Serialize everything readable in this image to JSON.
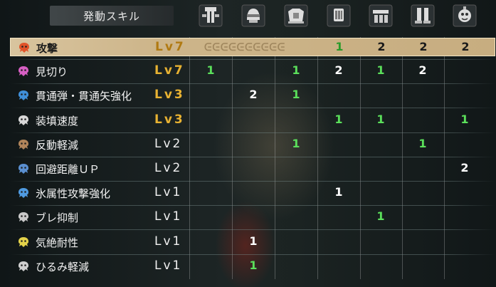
{
  "header": {
    "title": "発動スキル",
    "equipment": [
      {
        "slot": "weapon",
        "icon": "weapon-icon"
      },
      {
        "slot": "head",
        "icon": "helmet-icon"
      },
      {
        "slot": "chest",
        "icon": "chest-armor-icon"
      },
      {
        "slot": "arms",
        "icon": "gauntlet-icon"
      },
      {
        "slot": "waist",
        "icon": "waist-armor-icon"
      },
      {
        "slot": "legs",
        "icon": "greaves-icon"
      },
      {
        "slot": "charm",
        "icon": "charm-icon"
      }
    ]
  },
  "skills": [
    {
      "name": "攻撃",
      "level": "Lv7",
      "maxed": true,
      "icon_color": "#e0542a",
      "selected": true,
      "counts": [
        "",
        "",
        "",
        "1",
        "2",
        "2",
        "2"
      ],
      "count_colors": [
        "",
        "",
        "",
        "green",
        "white",
        "white",
        "white"
      ],
      "pattern": "ᕮᕮᕮᕮᕮᕮᕮᕮᕮᕮ"
    },
    {
      "name": "見切り",
      "level": "Lv7",
      "maxed": true,
      "icon_color": "#d65fc3",
      "counts": [
        "1",
        "",
        "1",
        "2",
        "1",
        "2",
        ""
      ],
      "count_colors": [
        "green",
        "",
        "green",
        "white",
        "green",
        "white",
        ""
      ]
    },
    {
      "name": "貫通弾・貫通矢強化",
      "level": "Lv3",
      "maxed": true,
      "icon_color": "#3f8fd8",
      "counts": [
        "",
        "2",
        "1",
        "",
        "",
        "",
        ""
      ],
      "count_colors": [
        "",
        "white",
        "green",
        "",
        "",
        "",
        ""
      ]
    },
    {
      "name": "装填速度",
      "level": "Lv3",
      "maxed": true,
      "icon_color": "#d8d8d8",
      "counts": [
        "",
        "",
        "",
        "1",
        "1",
        "",
        "1"
      ],
      "count_colors": [
        "",
        "",
        "",
        "green",
        "green",
        "",
        "green"
      ]
    },
    {
      "name": "反動軽減",
      "level": "Lv2",
      "maxed": false,
      "icon_color": "#b0845a",
      "counts": [
        "",
        "",
        "1",
        "",
        "",
        "1",
        ""
      ],
      "count_colors": [
        "",
        "",
        "green",
        "",
        "",
        "green",
        ""
      ]
    },
    {
      "name": "回避距離ＵＰ",
      "level": "Lv2",
      "maxed": false,
      "icon_color": "#5a8fd0",
      "counts": [
        "",
        "",
        "",
        "",
        "",
        "",
        "2"
      ],
      "count_colors": [
        "",
        "",
        "",
        "",
        "",
        "",
        "white"
      ]
    },
    {
      "name": "氷属性攻撃強化",
      "level": "Lv1",
      "maxed": false,
      "icon_color": "#4f9ae0",
      "counts": [
        "",
        "",
        "",
        "1",
        "",
        "",
        ""
      ],
      "count_colors": [
        "",
        "",
        "",
        "white",
        "",
        "",
        ""
      ]
    },
    {
      "name": "ブレ抑制",
      "level": "Lv1",
      "maxed": false,
      "icon_color": "#c9c9c9",
      "counts": [
        "",
        "",
        "",
        "",
        "1",
        "",
        ""
      ],
      "count_colors": [
        "",
        "",
        "",
        "",
        "green",
        "",
        ""
      ]
    },
    {
      "name": "気絶耐性",
      "level": "Lv1",
      "maxed": false,
      "icon_color": "#e3d24a",
      "counts": [
        "",
        "1",
        "",
        "",
        "",
        "",
        ""
      ],
      "count_colors": [
        "",
        "white",
        "",
        "",
        "",
        "",
        ""
      ]
    },
    {
      "name": "ひるみ軽減",
      "level": "Lv1",
      "maxed": false,
      "icon_color": "#cfcfcf",
      "counts": [
        "",
        "1",
        "",
        "",
        "",
        "",
        ""
      ],
      "count_colors": [
        "",
        "green",
        "",
        "",
        "",
        "",
        ""
      ]
    }
  ],
  "colors": {
    "selected_row": "#d8c49e",
    "maxed_level": "#e8b232",
    "count_green": "#5be05b",
    "count_white": "#ffffff"
  }
}
